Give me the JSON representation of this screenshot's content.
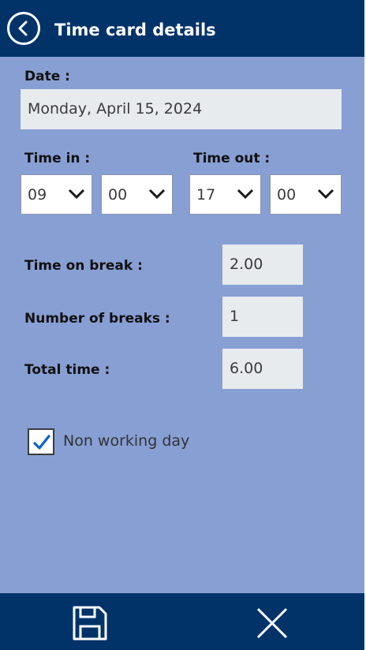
{
  "header": {
    "title": "Time card details"
  },
  "form": {
    "date_label": "Date :",
    "date_value": "Monday, April 15, 2024",
    "time_in_label": "Time in :",
    "time_out_label": "Time out :",
    "time_in_hour": "09",
    "time_in_minute": "00",
    "time_out_hour": "17",
    "time_out_minute": "00",
    "break_label": "Time on break :",
    "break_value": "2.00",
    "num_breaks_label": "Number of breaks :",
    "num_breaks_value": "1",
    "total_label": "Total time :",
    "total_value": "6.00",
    "non_working_label": "Non working day",
    "non_working_checked": true
  },
  "colors": {
    "header_bg": "#013369",
    "page_bg": "#889fd4",
    "check_color": "#0c62c7"
  },
  "icons": {
    "back": "back-arrow-icon",
    "dropdown": "chevron-down-icon",
    "save": "save-floppy-icon",
    "cancel": "close-icon",
    "check": "check-icon"
  }
}
